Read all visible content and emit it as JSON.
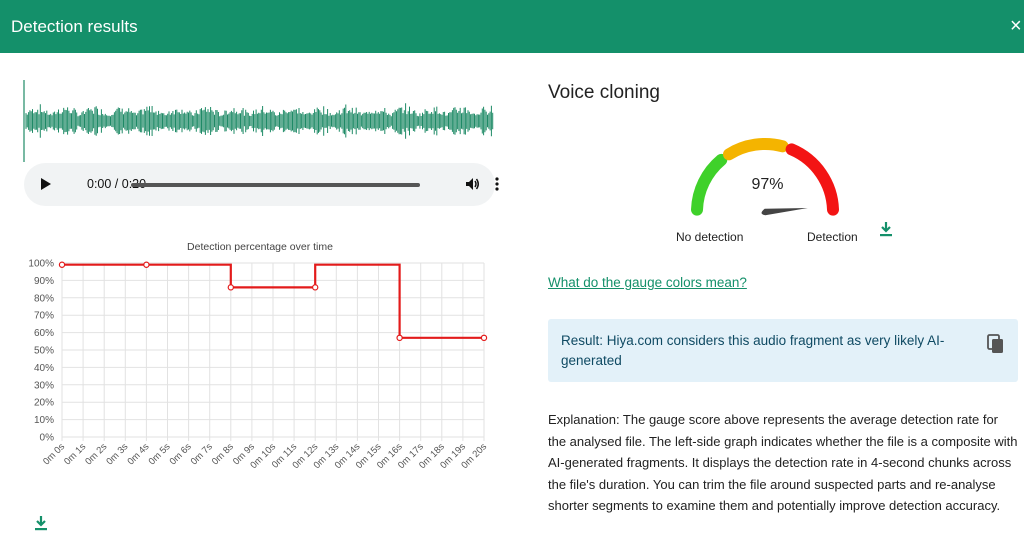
{
  "header": {
    "title": "Detection results",
    "close_label": "×"
  },
  "player": {
    "time": "0:00 / 0:20"
  },
  "chart_data": {
    "type": "line",
    "title": "Detection percentage over time",
    "xlabel": "",
    "ylabel": "",
    "x": [
      "0m 0s",
      "0m 1s",
      "0m 2s",
      "0m 3s",
      "0m 4s",
      "0m 5s",
      "0m 6s",
      "0m 7s",
      "0m 8s",
      "0m 9s",
      "0m 10s",
      "0m 11s",
      "0m 12s",
      "0m 13s",
      "0m 14s",
      "0m 15s",
      "0m 16s",
      "0m 17s",
      "0m 18s",
      "0m 19s",
      "0m 20s"
    ],
    "y_ticks": [
      "0%",
      "10%",
      "20%",
      "30%",
      "40%",
      "50%",
      "60%",
      "70%",
      "80%",
      "90%",
      "100%"
    ],
    "ylim": [
      0,
      100
    ],
    "series": [
      {
        "color": "#e31b1b",
        "points": [
          [
            0,
            99
          ],
          [
            4,
            99
          ],
          [
            8,
            99
          ],
          [
            8,
            86
          ],
          [
            12,
            86
          ],
          [
            12,
            99
          ],
          [
            16,
            99
          ],
          [
            16,
            57
          ],
          [
            20,
            57
          ]
        ]
      }
    ],
    "markers": [
      [
        0,
        99
      ],
      [
        4,
        99
      ],
      [
        8,
        86
      ],
      [
        12,
        86
      ],
      [
        16,
        57
      ],
      [
        20,
        57
      ]
    ],
    "grid": true,
    "legend": "none",
    "step": true
  },
  "voice": {
    "title": "Voice cloning",
    "score": "97%",
    "score_value": 97,
    "label_low": "No detection",
    "label_high": "Detection",
    "colors": [
      "#3fd12a",
      "#f4b400",
      "#f31414"
    ]
  },
  "gauge_link": "What do the gauge colors mean?",
  "result": {
    "text": "Result: Hiya.com considers this audio fragment as very likely AI-generated"
  },
  "explanation": "Explanation: The gauge score above represents the average detection rate for the analysed file. The left-side graph indicates whether the file is a composite with AI-generated fragments. It displays the detection rate in 4-second chunks across the file's duration. You can trim the file around suspected parts and re-analyse shorter segments to examine them and potentially improve detection accuracy.",
  "icons": {
    "play": "play-icon",
    "volume": "volume-icon",
    "more": "more-vertical-icon",
    "download": "download-icon",
    "copy": "copy-icon",
    "close": "close-icon"
  }
}
